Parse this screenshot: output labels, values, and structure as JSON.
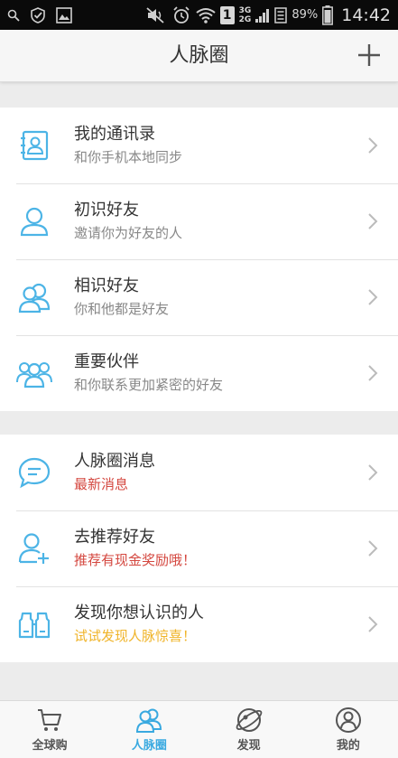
{
  "status_bar": {
    "sim_slot": "1",
    "network_top": "3G",
    "network_bottom": "2G",
    "battery": "89%",
    "time": "14:42"
  },
  "header": {
    "title": "人脉圈",
    "add_icon": "plus-icon"
  },
  "group1": [
    {
      "title": "我的通讯录",
      "subtitle": "和你手机本地同步",
      "icon": "contacts-book-icon"
    },
    {
      "title": "初识好友",
      "subtitle": "邀请你为好友的人",
      "icon": "single-person-icon"
    },
    {
      "title": "相识好友",
      "subtitle": "你和他都是好友",
      "icon": "two-persons-icon"
    },
    {
      "title": "重要伙伴",
      "subtitle": "和你联系更加紧密的好友",
      "icon": "group-persons-icon"
    }
  ],
  "group2": [
    {
      "title": "人脉圈消息",
      "subtitle": "最新消息",
      "icon": "chat-bubble-icon",
      "subtitle_color": "#d4473f"
    },
    {
      "title": "去推荐好友",
      "subtitle": "推荐有现金奖励哦！",
      "icon": "add-person-icon",
      "subtitle_color": "#d4473f"
    },
    {
      "title": "发现你想认识的人",
      "subtitle": "试试发现人脉惊喜！",
      "icon": "binoculars-icon",
      "subtitle_color": "#f0b429"
    }
  ],
  "tabs": [
    {
      "label": "全球购",
      "icon": "cart-icon",
      "active": false
    },
    {
      "label": "人脉圈",
      "icon": "people-circle-icon",
      "active": true
    },
    {
      "label": "发现",
      "icon": "planet-icon",
      "active": false
    },
    {
      "label": "我的",
      "icon": "profile-icon",
      "active": false
    }
  ],
  "colors": {
    "accent": "#39a9e0",
    "icon_blue": "#4cb4e6",
    "red_text": "#d4473f",
    "yellow_text": "#f0b429"
  }
}
